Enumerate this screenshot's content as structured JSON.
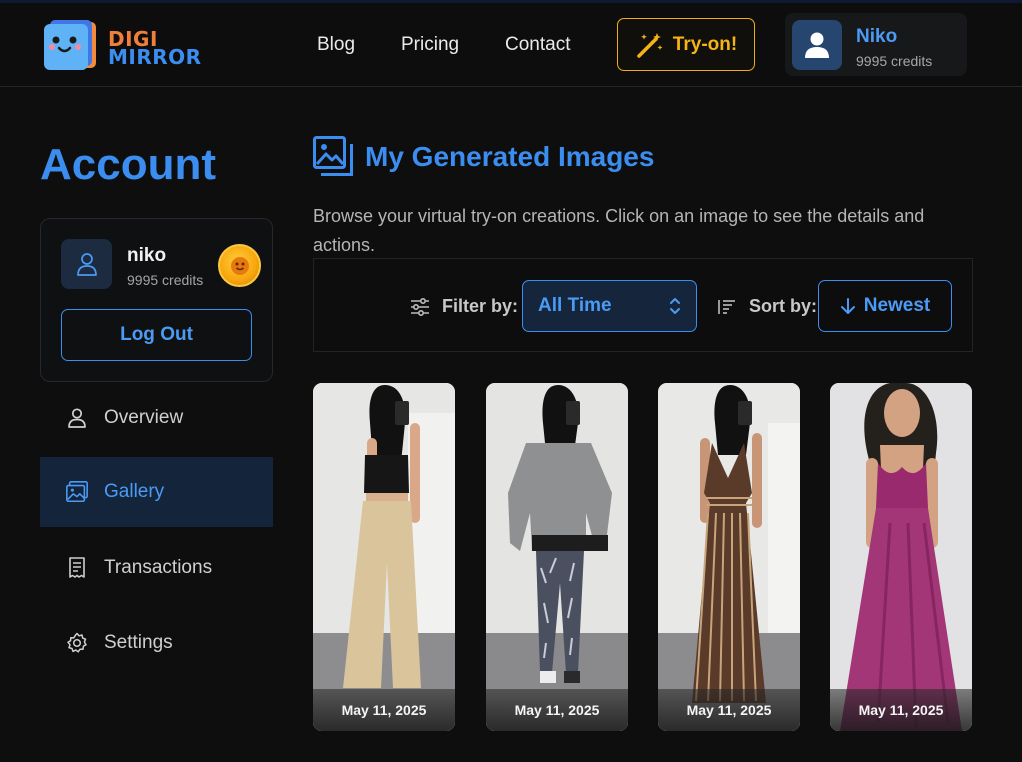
{
  "brand": {
    "line1": "DIGI",
    "line2": "MIRROR"
  },
  "nav": {
    "blog": "Blog",
    "pricing": "Pricing",
    "contact": "Contact",
    "tryon": "Try-on!"
  },
  "user": {
    "name": "Niko",
    "credits": "9995 credits"
  },
  "sidebar": {
    "title": "Account",
    "profile": {
      "name": "niko",
      "credits": "9995 credits"
    },
    "logout_label": "Log Out",
    "items": [
      {
        "label": "Overview",
        "icon": "user-icon"
      },
      {
        "label": "Gallery",
        "icon": "image-icon",
        "active": true
      },
      {
        "label": "Transactions",
        "icon": "receipt-icon"
      },
      {
        "label": "Settings",
        "icon": "gear-icon"
      }
    ]
  },
  "main": {
    "title": "My Generated Images",
    "description": "Browse your virtual try-on creations. Click on an image to see the details and actions.",
    "filter": {
      "label": "Filter by:",
      "value": "All Time"
    },
    "sort": {
      "label": "Sort by:",
      "value": "Newest"
    },
    "images": [
      {
        "date": "May 11, 2025",
        "outfit": "black crop top and beige wide-leg trousers"
      },
      {
        "date": "May 11, 2025",
        "outfit": "grey sweater and patterned leggings"
      },
      {
        "date": "May 11, 2025",
        "outfit": "brown striped maxi dress"
      },
      {
        "date": "May 11, 2025",
        "outfit": "magenta maxi dress"
      }
    ]
  },
  "colors": {
    "accent": "#3b8ef0",
    "tryon": "#f1ad16",
    "background": "#0e0e0f"
  }
}
